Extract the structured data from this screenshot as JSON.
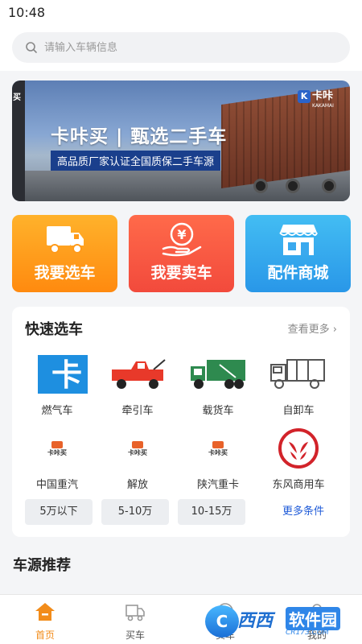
{
  "status_bar": {
    "time": "10:48"
  },
  "search": {
    "placeholder": "请输入车辆信息"
  },
  "banner": {
    "side_text": "买",
    "logo_text": "卡咔",
    "logo_sub": "KAKAMAI",
    "title": "卡咔买 | 甄选二手车",
    "subtitle": "高品质厂家认证全国质保二手车源"
  },
  "tiles": [
    {
      "label": "我要选车",
      "icon": "truck-icon"
    },
    {
      "label": "我要卖车",
      "icon": "yen-coin-hand-icon"
    },
    {
      "label": "配件商城",
      "icon": "store-icon"
    }
  ],
  "quick_select": {
    "title": "快速选车",
    "more": "查看更多",
    "types": [
      {
        "label": "燃气车",
        "icon": "gas-vehicle-icon"
      },
      {
        "label": "牵引车",
        "icon": "tow-truck-icon"
      },
      {
        "label": "载货车",
        "icon": "cargo-truck-icon"
      },
      {
        "label": "自卸车",
        "icon": "dump-truck-icon"
      }
    ],
    "brands": [
      {
        "label": "中国重汽",
        "logo_text": "卡咔买"
      },
      {
        "label": "解放",
        "logo_text": "卡咔买"
      },
      {
        "label": "陕汽重卡",
        "logo_text": "卡咔买"
      },
      {
        "label": "东风商用车",
        "icon": "dongfeng-logo-icon"
      }
    ],
    "price_ranges": [
      "5万以下",
      "5-10万",
      "10-15万"
    ],
    "more_conditions": "更多条件"
  },
  "recommend": {
    "title": "车源推荐"
  },
  "tabbar": {
    "items": [
      {
        "label": "首页",
        "icon": "home-icon",
        "active": true
      },
      {
        "label": "买车",
        "icon": "buy-truck-icon",
        "active": false
      },
      {
        "label": "卖车",
        "icon": "sell-icon",
        "active": false
      },
      {
        "label": "我的",
        "icon": "profile-icon",
        "active": false
      }
    ]
  },
  "watermark": {
    "badge": "C",
    "name": "西西",
    "soft": "软件园",
    "domain": "CR173.COM"
  },
  "colors": {
    "accent": "#f28c1a",
    "link": "#1f5bd8",
    "sell_red": "#e8392a",
    "cargo_green": "#2e8a4f"
  }
}
